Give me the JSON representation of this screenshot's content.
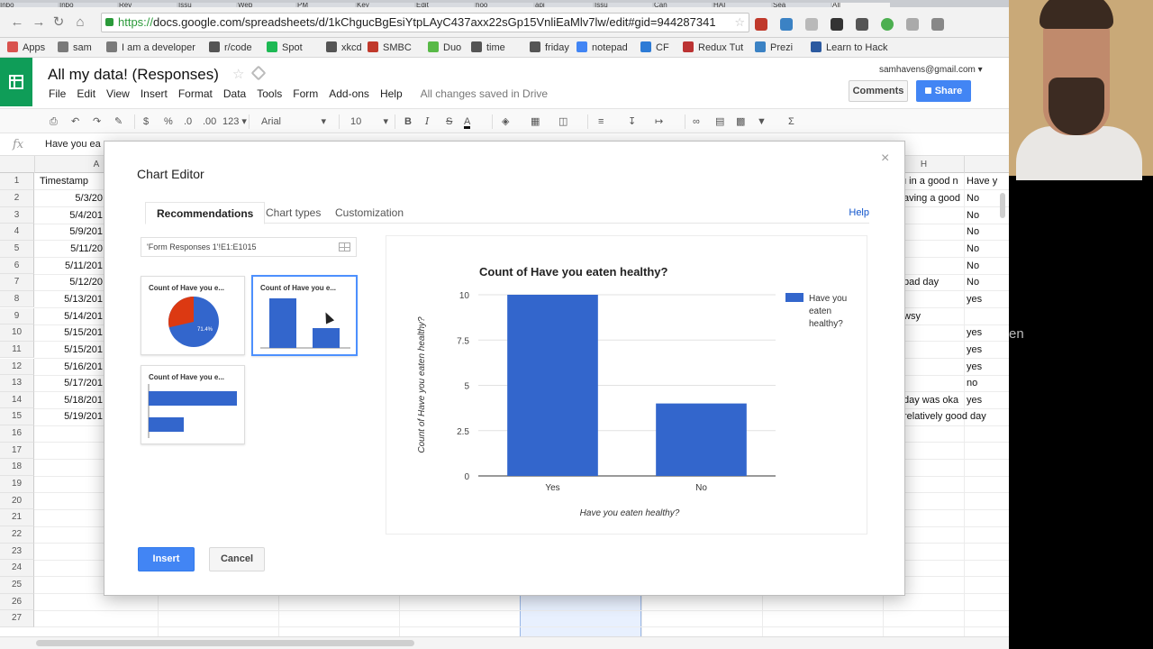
{
  "browser": {
    "url_https": "https://",
    "url_rest": "docs.google.com/spreadsheets/d/1kChgucBgEsiYtpLAyC437axx22sGp15VnliEaMlv7lw/edit#gid=944287341",
    "tabs": [
      "Inbo",
      "Inbo",
      "Rev",
      "Issu",
      "Web",
      "PM",
      "Key",
      "Edit",
      "hoo",
      "api",
      "Issu",
      "Can",
      "HAI",
      "Sea",
      "All"
    ],
    "bookmarks": [
      "Apps",
      "sam",
      "I am a developer",
      "r/code",
      "Spot",
      "xkcd",
      "SMBC",
      "Duo",
      "time",
      "friday",
      "notepad",
      "CF",
      "Redux Tut",
      "Prezi",
      "Learn to Hack"
    ]
  },
  "sheet": {
    "title": "All my data!  (Responses)",
    "account": "samhavens@gmail.com",
    "menu": [
      "File",
      "Edit",
      "View",
      "Insert",
      "Format",
      "Data",
      "Tools",
      "Form",
      "Add-ons",
      "Help"
    ],
    "saved_status": "All changes saved in Drive",
    "comments_label": "Comments",
    "share_label": "Share",
    "toolbar": {
      "currency": "$",
      "percent": "%",
      "dec_decrease": ".0",
      "dec_increase": ".00",
      "number_format": "123",
      "font": "Arial",
      "font_size": "10",
      "bold": "B",
      "italic": "I",
      "strike": "S",
      "text_color": "A",
      "sum": "Σ"
    },
    "formula_text": "Have you ea",
    "columns": [
      "A",
      "H"
    ],
    "header_row": {
      "a": "Timestamp",
      "h_left": "u in a good n",
      "h_right": "Have y"
    },
    "rows": [
      {
        "num": "2",
        "a": "5/3/20",
        "h": "aving a good",
        "i": "No"
      },
      {
        "num": "3",
        "a": "5/4/201",
        "h": "",
        "i": "No"
      },
      {
        "num": "4",
        "a": "5/9/201",
        "h": "",
        "i": "No"
      },
      {
        "num": "5",
        "a": "5/11/20",
        "h": "",
        "i": "No"
      },
      {
        "num": "6",
        "a": "5/11/201",
        "h": "",
        "i": "No"
      },
      {
        "num": "7",
        "a": "5/12/20",
        "h": "bad day",
        "i": "No"
      },
      {
        "num": "8",
        "a": "5/13/201",
        "h": "",
        "i": "yes"
      },
      {
        "num": "9",
        "a": "5/14/201",
        "h": "wsy",
        "i": ""
      },
      {
        "num": "10",
        "a": "5/15/201",
        "h": "",
        "i": "yes"
      },
      {
        "num": "11",
        "a": "5/15/201",
        "h": "",
        "i": "yes"
      },
      {
        "num": "12",
        "a": "5/16/201",
        "h": "",
        "i": "yes"
      },
      {
        "num": "13",
        "a": "5/17/201",
        "h": "",
        "i": "no"
      },
      {
        "num": "14",
        "a": "5/18/201",
        "h": "day was oka",
        "i": "yes"
      },
      {
        "num": "15",
        "a": "5/19/201",
        "h": "relatively good day",
        "i": ""
      },
      {
        "num": "16",
        "a": "",
        "h": "",
        "i": ""
      },
      {
        "num": "17",
        "a": "",
        "h": "",
        "i": ""
      },
      {
        "num": "18",
        "a": "",
        "h": "",
        "i": ""
      },
      {
        "num": "19",
        "a": "",
        "h": "",
        "i": ""
      },
      {
        "num": "20",
        "a": "",
        "h": "",
        "i": ""
      },
      {
        "num": "21",
        "a": "",
        "h": "",
        "i": ""
      },
      {
        "num": "22",
        "a": "",
        "h": "",
        "i": ""
      },
      {
        "num": "23",
        "a": "",
        "h": "",
        "i": ""
      },
      {
        "num": "24",
        "a": "",
        "h": "",
        "i": ""
      },
      {
        "num": "25",
        "a": "",
        "h": "",
        "i": ""
      },
      {
        "num": "26",
        "a": "",
        "h": "",
        "i": ""
      },
      {
        "num": "27",
        "a": "",
        "h": "",
        "i": ""
      }
    ]
  },
  "dialog": {
    "title": "Chart Editor",
    "close": "×",
    "tabs": [
      "Recommendations",
      "Chart types",
      "Customization"
    ],
    "help": "Help",
    "range": "'Form Responses 1'!E1:E1015",
    "thumbnail_title": "Count of Have you e...",
    "pie_label": "71.4%",
    "insert_label": "Insert",
    "cancel_label": "Cancel"
  },
  "webcam": {
    "partial_text": "en"
  },
  "colors": {
    "bar": "#3366cc",
    "pie_red": "#dc3912",
    "accent": "#4285f4",
    "sheets_green": "#0f9d58"
  },
  "chart_data": {
    "type": "bar",
    "title": "Count of Have you eaten healthy?",
    "xlabel": "Have you eaten healthy?",
    "ylabel": "Count of Have you eaten healthy?",
    "categories": [
      "Yes",
      "No"
    ],
    "series": [
      {
        "name": "Have you eaten healthy?",
        "values": [
          10,
          4
        ]
      }
    ],
    "ylim": [
      0,
      10
    ],
    "yticks": [
      "0",
      "2.5",
      "5",
      "7.5",
      "10"
    ],
    "legend": "right",
    "grid": true
  }
}
